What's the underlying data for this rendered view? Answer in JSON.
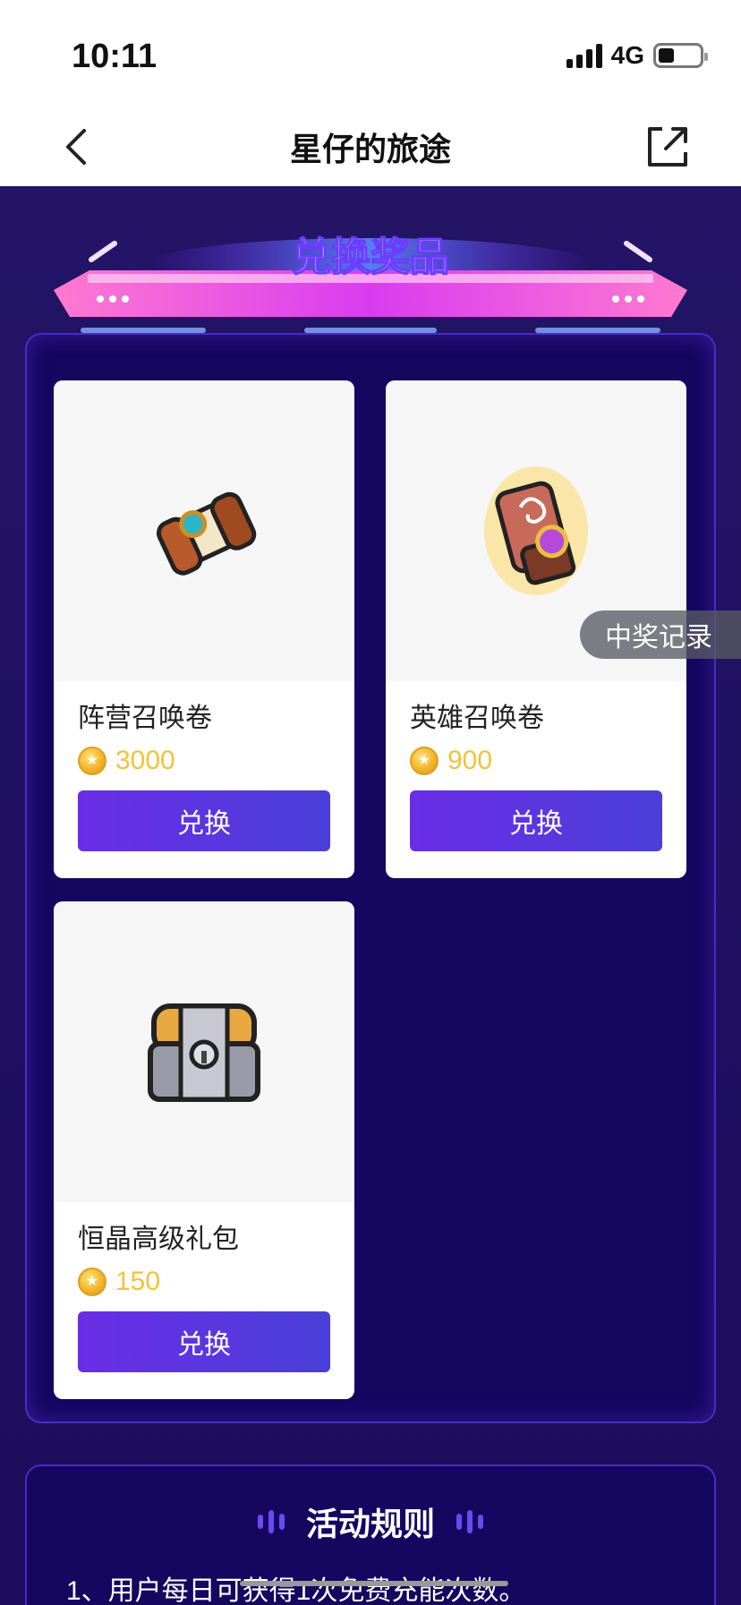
{
  "status_bar": {
    "time": "10:11",
    "network": "4G"
  },
  "nav": {
    "title": "星仔的旅途",
    "back_icon": "chevron-left-icon",
    "share_icon": "external-link-icon"
  },
  "banner": {
    "title": "兑换奖品"
  },
  "products": [
    {
      "name": "阵营召唤卷",
      "price": "3000",
      "button": "兑换",
      "image": "faction-scroll-icon"
    },
    {
      "name": "英雄召唤卷",
      "price": "900",
      "button": "兑换",
      "image": "hero-scroll-icon"
    },
    {
      "name": "恒晶高级礼包",
      "price": "150",
      "button": "兑换",
      "image": "treasure-chest-icon"
    }
  ],
  "record_tab": {
    "label": "中奖记录"
  },
  "rules": {
    "title": "活动规则",
    "lines": [
      "1、用户每日可获得1次免费充能次数。"
    ]
  },
  "colors": {
    "background": "#1c0e5c",
    "panel": "#150660",
    "button_start": "#6a2de6",
    "button_end": "#4a3fd8",
    "price": "#f2c23a"
  }
}
